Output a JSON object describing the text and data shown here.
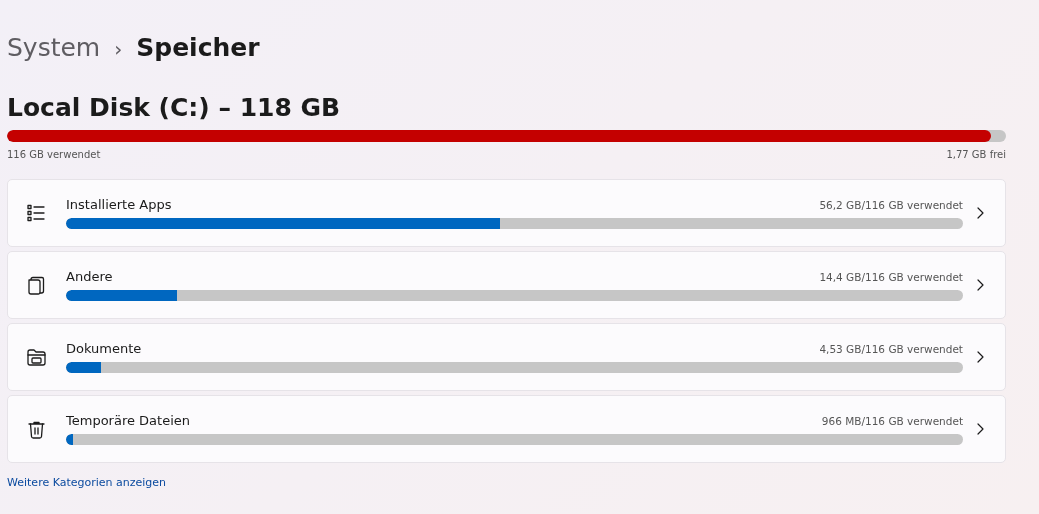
{
  "breadcrumb": {
    "parent": "System",
    "separator": "›",
    "current": "Speicher"
  },
  "disk": {
    "title": "Local Disk (C:) – 118 GB",
    "level": 0.985,
    "used": "116 GB verwendet",
    "free": "1,77 GB frei"
  },
  "categories": [
    {
      "kind": "apps",
      "label": "Installierte Apps",
      "usage": "56,2 GB/116 GB verwendet",
      "level": 0.484
    },
    {
      "kind": "other",
      "label": "Andere",
      "usage": "14,4 GB/116 GB verwendet",
      "level": 0.124
    },
    {
      "kind": "documents",
      "label": "Dokumente",
      "usage": "4,53 GB/116 GB verwendet",
      "level": 0.039
    },
    {
      "kind": "temp",
      "label": "Temporäre Dateien",
      "usage": "966 MB/116 GB verwendet",
      "level": 0.008
    }
  ],
  "more_link": "Weitere Kategorien anzeigen"
}
